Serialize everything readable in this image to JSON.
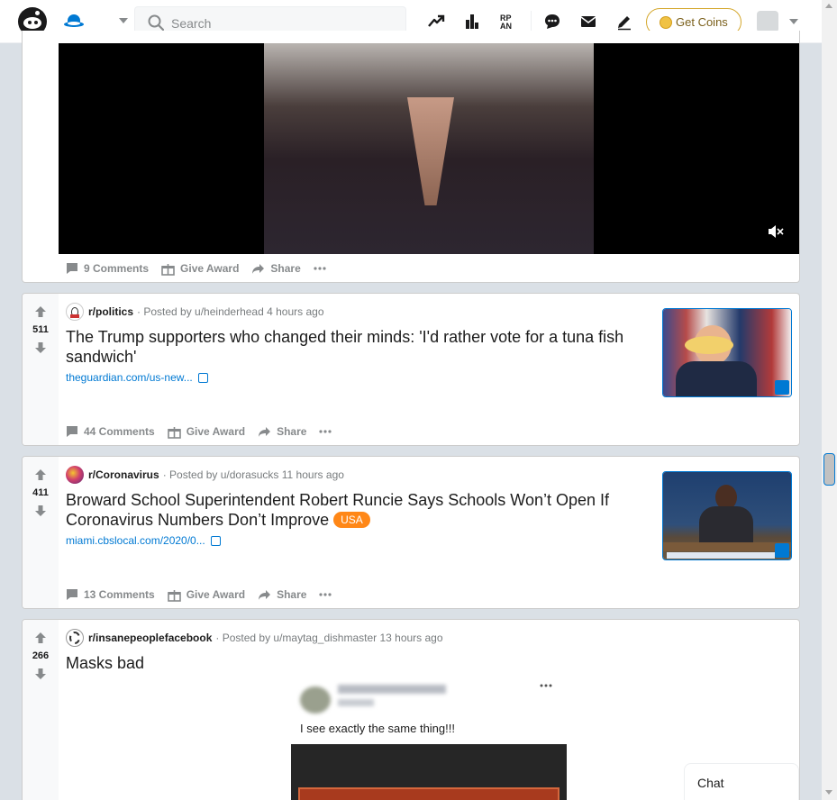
{
  "header": {
    "search_placeholder": "Search",
    "get_coins_label": "Get Coins",
    "icons": [
      "reddit-logo",
      "home-icon",
      "trending-icon",
      "leaderboard-icon",
      "rpan-icon",
      "chat-icon",
      "mail-icon",
      "create-post-icon",
      "coin-icon",
      "avatar"
    ]
  },
  "top_post": {
    "comments_label": "9 Comments",
    "award_label": "Give Award",
    "share_label": "Share"
  },
  "posts": [
    {
      "votes": "511",
      "subreddit": "r/politics",
      "posted_by": "· Posted by u/heinderhead 4 hours ago",
      "title": "The Trump supporters who changed their minds: 'I'd rather vote for a tuna fish sandwich'",
      "link": "theguardian.com/us-new...",
      "comments_label": "44 Comments",
      "award_label": "Give Award",
      "share_label": "Share"
    },
    {
      "votes": "411",
      "subreddit": "r/Coronavirus",
      "posted_by": "· Posted by u/dorasucks 11 hours ago",
      "title": "Broward School Superintendent Robert Runcie Says Schools Won’t Open If Coronavirus Numbers Don’t Improve",
      "flair": "USA",
      "link": "miami.cbslocal.com/2020/0...",
      "comments_label": "13 Comments",
      "award_label": "Give Award",
      "share_label": "Share"
    },
    {
      "votes": "266",
      "subreddit": "r/insanepeoplefacebook",
      "posted_by": "· Posted by u/maytag_dishmaster 13 hours ago",
      "title": "Masks bad",
      "image_text": "I see exactly the same thing!!!"
    }
  ],
  "chat": {
    "label": "Chat"
  },
  "colors": {
    "accent": "#0079d3",
    "flair": "#ff8717",
    "background": "#dae0e6"
  }
}
